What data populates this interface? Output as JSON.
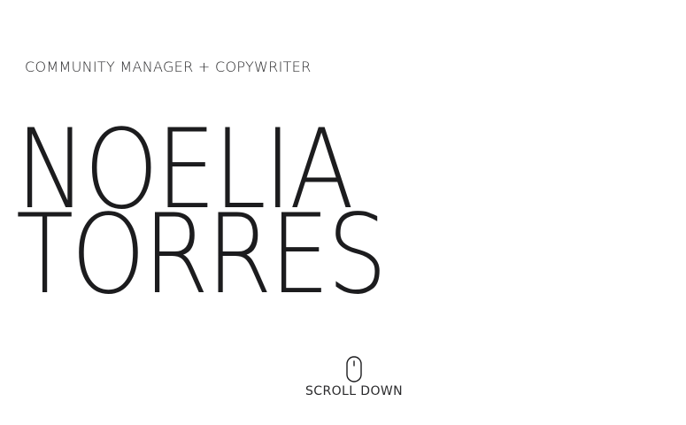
{
  "hero": {
    "subtitle": "COMMUNITY MANAGER + COPYWRITER",
    "first_name": "NOELIA",
    "last_name": "TORRES"
  },
  "scroll": {
    "label": "SCROLL DOWN",
    "icon": "mouse-icon"
  },
  "colors": {
    "background": "#ffffff",
    "text": "#1c1c1e"
  }
}
